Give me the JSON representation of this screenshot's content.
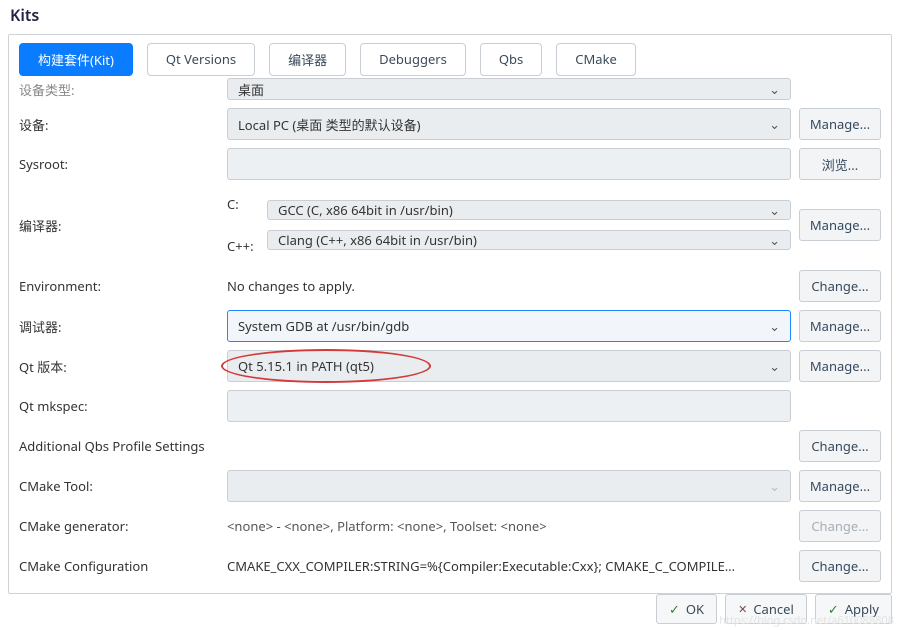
{
  "title": "Kits",
  "tabs": [
    "构建套件(Kit)",
    "Qt Versions",
    "编译器",
    "Debuggers",
    "Qbs",
    "CMake"
  ],
  "labels": {
    "device_type": "设备类型:",
    "device": "设备:",
    "sysroot": "Sysroot:",
    "compiler": "编译器:",
    "c": "C:",
    "cxx": "C++:",
    "env": "Environment:",
    "debugger": "调试器:",
    "qt": "Qt 版本:",
    "mkspec": "Qt mkspec:",
    "qbs": "Additional Qbs Profile Settings",
    "cmake_tool": "CMake Tool:",
    "cmake_gen": "CMake generator:",
    "cmake_conf": "CMake Configuration"
  },
  "values": {
    "device_type": "桌面",
    "device": "Local PC (桌面 类型的默认设备)",
    "sysroot": "",
    "c": "GCC (C, x86 64bit in /usr/bin)",
    "cxx": "Clang (C++, x86 64bit in /usr/bin)",
    "env": "No changes to apply.",
    "debugger": "System GDB at /usr/bin/gdb",
    "qt": "Qt 5.15.1 in PATH (qt5)",
    "mkspec": "",
    "cmake_tool": "",
    "cmake_gen": "<none> - <none>, Platform: <none>, Toolset: <none>",
    "cmake_conf": "CMAKE_CXX_COMPILER:STRING=%{Compiler:Executable:Cxx}; CMAKE_C_COMPILE…"
  },
  "buttons": {
    "manage": "Manage...",
    "browse": "浏览...",
    "change": "Change...",
    "ok": "OK",
    "cancel": "Cancel",
    "apply": "Apply"
  },
  "watermark": "https://blog.csdn.net/a610088808"
}
